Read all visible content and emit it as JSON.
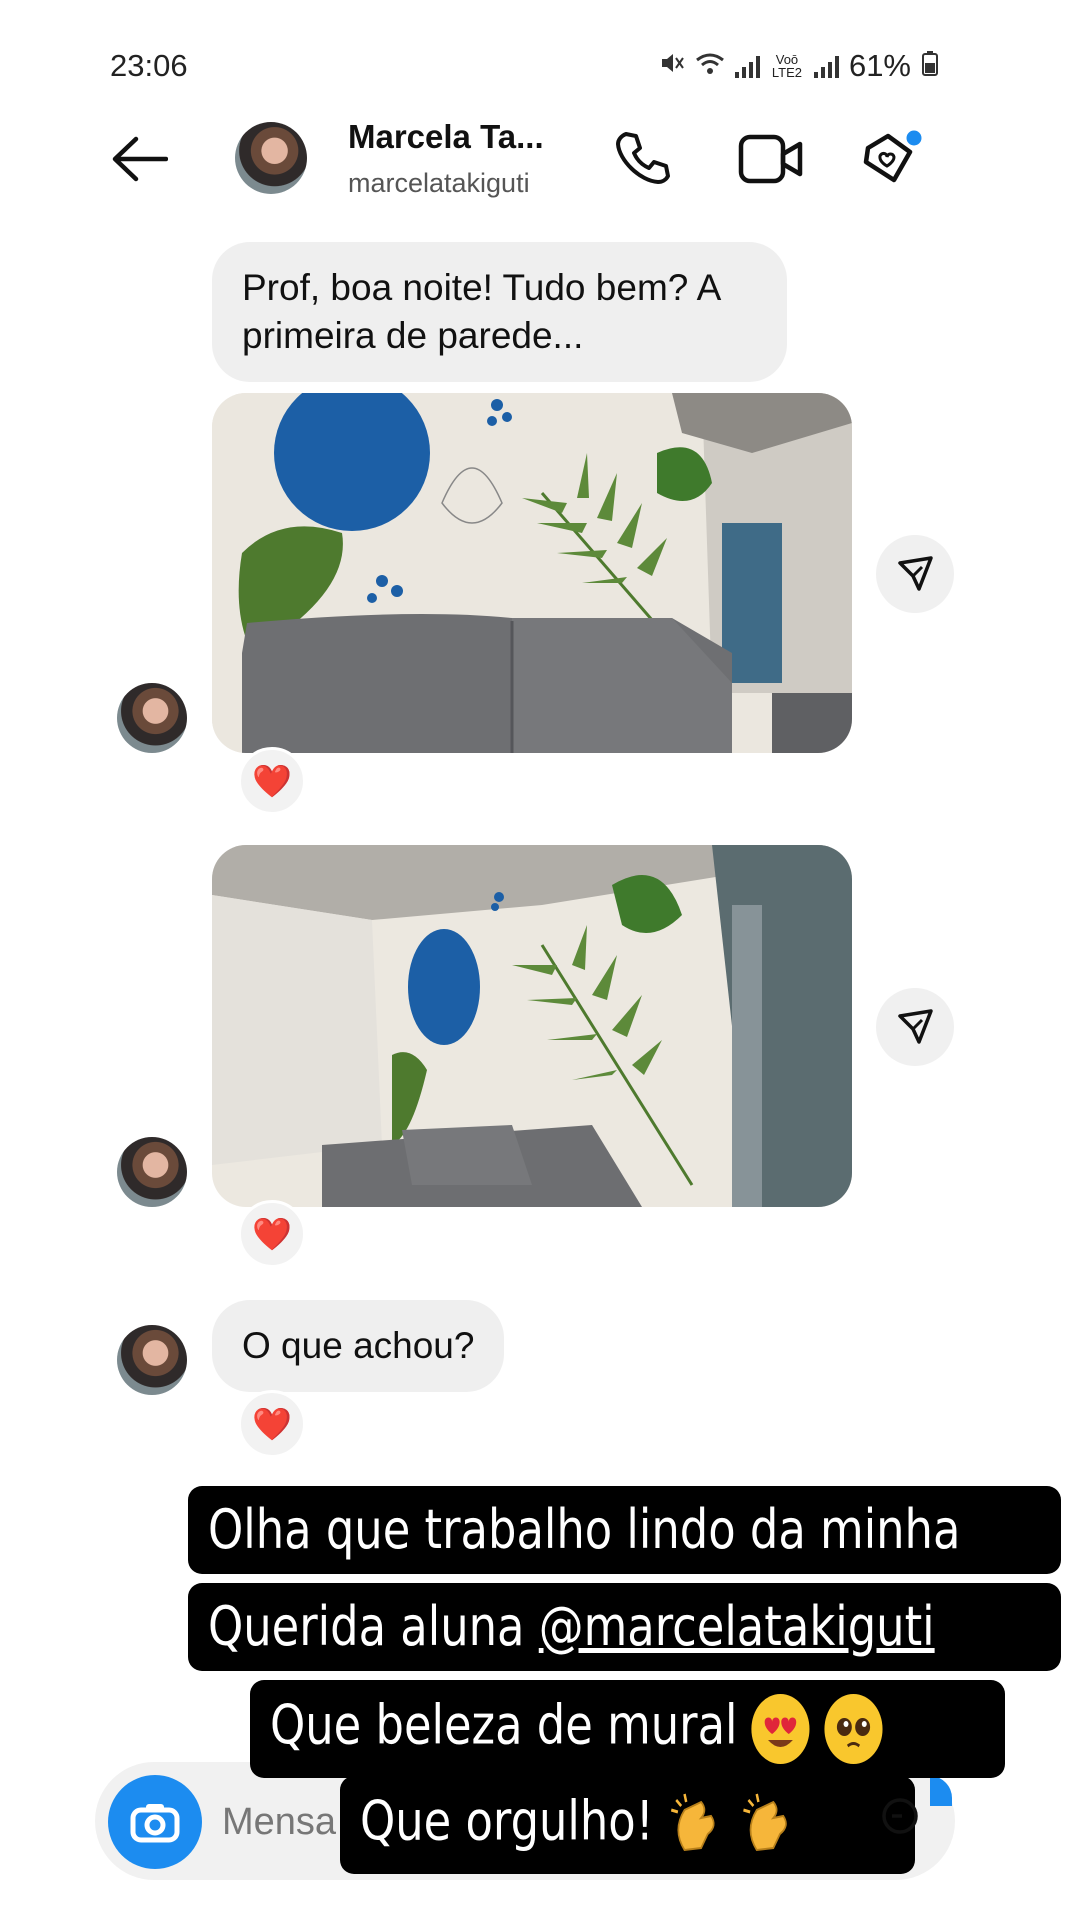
{
  "status_bar": {
    "time": "23:06",
    "network_label": "Voō LTE2",
    "battery_percent": "61%"
  },
  "header": {
    "back_icon": "arrow-left-icon",
    "contact_name": "Marcela Ta...",
    "contact_username": "marcelatakiguti",
    "call_icon": "phone-icon",
    "video_icon": "video-camera-icon",
    "extra_icon": "heart-tag-icon"
  },
  "messages": [
    {
      "type": "text",
      "text": "Prof, boa noite! Tudo bem? A primeira de parede..."
    },
    {
      "type": "image",
      "description": "",
      "reaction": "❤️"
    },
    {
      "type": "image",
      "description": "",
      "reaction": "❤️"
    },
    {
      "type": "text",
      "text": "O que achou?",
      "reaction": "❤️"
    }
  ],
  "story_caption": {
    "line1": "Olha que trabalho lindo da minha",
    "line2_prefix": "Querida aluna ",
    "line2_mention": "@marcelatakiguti",
    "line3": "Que beleza de mural",
    "line4": "Que orgulho!"
  },
  "composer": {
    "placeholder": "Mensa",
    "camera_icon": "camera-icon"
  },
  "colors": {
    "accent": "#1c8cf0",
    "bubble": "#efefef",
    "heart": "#e0263a",
    "mural_blue": "#1c5fa6",
    "leaf_green": "#4e7a2e"
  }
}
